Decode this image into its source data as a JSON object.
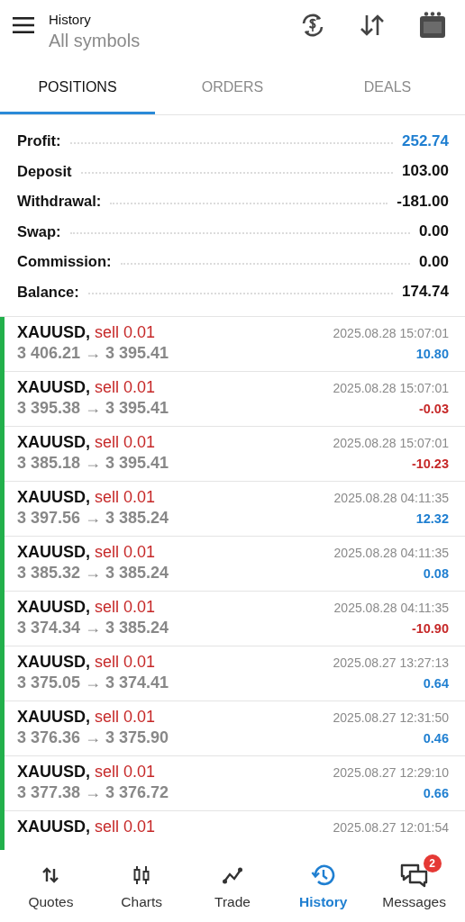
{
  "header": {
    "title": "History",
    "subtitle": "All symbols"
  },
  "tabs": [
    {
      "label": "POSITIONS",
      "selected": true
    },
    {
      "label": "ORDERS",
      "selected": false
    },
    {
      "label": "DEALS",
      "selected": false
    }
  ],
  "summary": [
    {
      "label": "Profit:",
      "value": "252.74",
      "highlight": true
    },
    {
      "label": "Deposit",
      "value": "103.00",
      "highlight": false
    },
    {
      "label": "Withdrawal:",
      "value": "-181.00",
      "highlight": false
    },
    {
      "label": "Swap:",
      "value": "0.00",
      "highlight": false
    },
    {
      "label": "Commission:",
      "value": "0.00",
      "highlight": false
    },
    {
      "label": "Balance:",
      "value": "174.74",
      "highlight": false
    }
  ],
  "positions": [
    {
      "symbol": "XAUUSD,",
      "side": "sell 0.01",
      "prices": "3 406.21 → 3 395.41",
      "time": "2025.08.28 15:07:01",
      "profit": "10.80",
      "loss": false
    },
    {
      "symbol": "XAUUSD,",
      "side": "sell 0.01",
      "prices": "3 395.38 → 3 395.41",
      "time": "2025.08.28 15:07:01",
      "profit": "-0.03",
      "loss": true
    },
    {
      "symbol": "XAUUSD,",
      "side": "sell 0.01",
      "prices": "3 385.18 → 3 395.41",
      "time": "2025.08.28 15:07:01",
      "profit": "-10.23",
      "loss": true
    },
    {
      "symbol": "XAUUSD,",
      "side": "sell 0.01",
      "prices": "3 397.56 → 3 385.24",
      "time": "2025.08.28 04:11:35",
      "profit": "12.32",
      "loss": false
    },
    {
      "symbol": "XAUUSD,",
      "side": "sell 0.01",
      "prices": "3 385.32 → 3 385.24",
      "time": "2025.08.28 04:11:35",
      "profit": "0.08",
      "loss": false
    },
    {
      "symbol": "XAUUSD,",
      "side": "sell 0.01",
      "prices": "3 374.34 → 3 385.24",
      "time": "2025.08.28 04:11:35",
      "profit": "-10.90",
      "loss": true
    },
    {
      "symbol": "XAUUSD,",
      "side": "sell 0.01",
      "prices": "3 375.05 → 3 374.41",
      "time": "2025.08.27 13:27:13",
      "profit": "0.64",
      "loss": false
    },
    {
      "symbol": "XAUUSD,",
      "side": "sell 0.01",
      "prices": "3 376.36 → 3 375.90",
      "time": "2025.08.27 12:31:50",
      "profit": "0.46",
      "loss": false
    },
    {
      "symbol": "XAUUSD,",
      "side": "sell 0.01",
      "prices": "3 377.38 → 3 376.72",
      "time": "2025.08.27 12:29:10",
      "profit": "0.66",
      "loss": false
    },
    {
      "symbol": "XAUUSD,",
      "side": "sell 0.01",
      "time": "2025.08.27 12:01:54"
    }
  ],
  "nav": [
    {
      "label": "Quotes",
      "selected": false
    },
    {
      "label": "Charts",
      "selected": false
    },
    {
      "label": "Trade",
      "selected": false
    },
    {
      "label": "History",
      "selected": true
    },
    {
      "label": "Messages",
      "selected": false,
      "badge": "2"
    }
  ]
}
